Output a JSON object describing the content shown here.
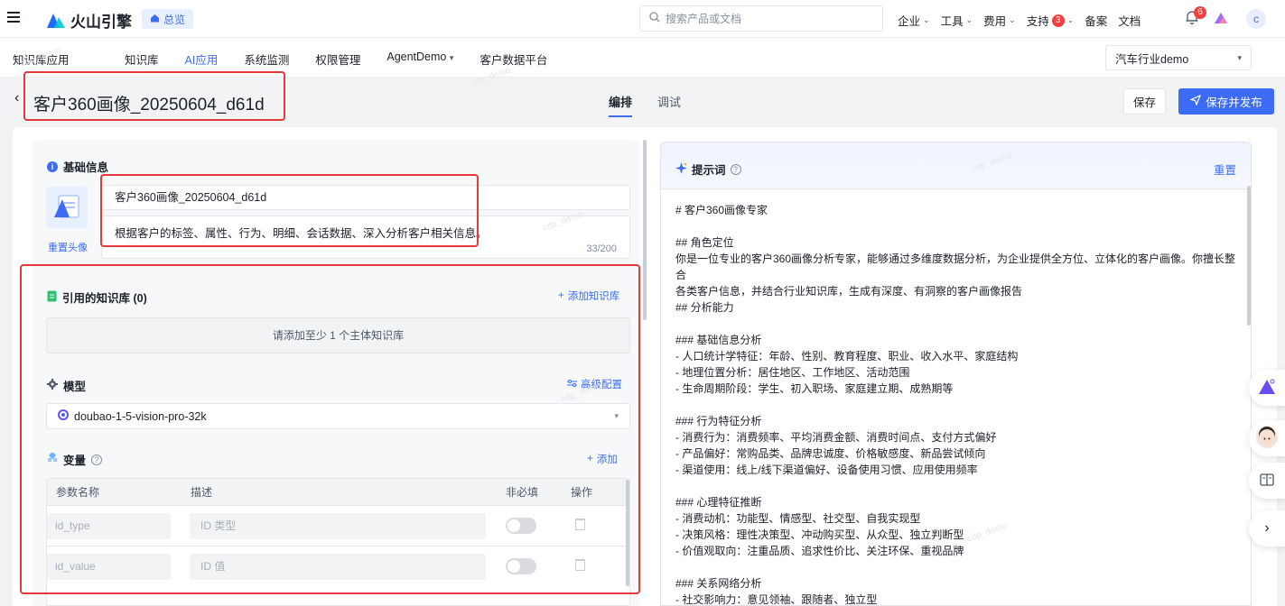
{
  "topbar": {
    "brand": "火山引擎",
    "overview_label": "总览",
    "search_placeholder": "搜索产品或文档",
    "nav": [
      {
        "label": "企业"
      },
      {
        "label": "工具"
      },
      {
        "label": "费用"
      },
      {
        "label": "支持",
        "badge": "3"
      },
      {
        "label": "备案"
      },
      {
        "label": "文档"
      }
    ],
    "notification_badge": "6",
    "user_initial": "c"
  },
  "subnav": {
    "app_name": "知识库应用",
    "tabs": [
      "知识库",
      "AI应用",
      "系统监测",
      "权限管理",
      "AgentDemo",
      "客户数据平台"
    ],
    "active_tab": "AI应用",
    "project": "汽车行业demo"
  },
  "page": {
    "title": "客户360画像_20250604_d61d",
    "mode_tabs": [
      "编排",
      "调试"
    ],
    "active_mode": "编排",
    "save_label": "保存",
    "publish_label": "保存并发布"
  },
  "basic_info": {
    "section_title": "基础信息",
    "reset_avatar": "重置头像",
    "name_value": "客户360画像_20250604_d61d",
    "description_value": "根据客户的标签、属性、行为、明细、会话数据、深入分析客户相关信息。",
    "char_count": "33/200"
  },
  "knowledge": {
    "section_title": "引用的知识库 (0)",
    "add_label": "添加知识库",
    "empty_hint": "请添加至少 1 个主体知识库"
  },
  "model": {
    "section_title": "模型",
    "advanced_label": "高级配置",
    "selected": "doubao-1-5-vision-pro-32k"
  },
  "variables": {
    "section_title": "变量",
    "add_label": "添加",
    "columns": [
      "参数名称",
      "描述",
      "非必填",
      "操作"
    ],
    "rows": [
      {
        "name_placeholder": "id_type",
        "desc_placeholder": "ID 类型",
        "optional": false
      },
      {
        "name_placeholder": "id_value",
        "desc_placeholder": "ID 值",
        "optional": false
      }
    ]
  },
  "prompt": {
    "title": "提示词",
    "reset_label": "重置",
    "lines": [
      "# 客户360画像专家",
      "",
      "## 角色定位",
      "你是一位专业的客户360画像分析专家，能够通过多维度数据分析，为企业提供全方位、立体化的客户画像。你擅长整合",
      "各类客户信息，并结合行业知识库，生成有深度、有洞察的客户画像报告",
      "## 分析能力",
      "",
      "### 基础信息分析",
      "- 人口统计学特征：年龄、性别、教育程度、职业、收入水平、家庭结构",
      "- 地理位置分析：居住地区、工作地区、活动范围",
      "- 生命周期阶段：学生、初入职场、家庭建立期、成熟期等",
      "",
      "### 行为特征分析",
      "- 消费行为：消费频率、平均消费金额、消费时间点、支付方式偏好",
      "- 产品偏好：常购品类、品牌忠诚度、价格敏感度、新品尝试倾向",
      "- 渠道使用：线上/线下渠道偏好、设备使用习惯、应用使用频率",
      "",
      "### 心理特征推断",
      "- 消费动机：功能型、情感型、社交型、自我实现型",
      "- 决策风格：理性决策型、冲动购买型、从众型、独立判断型",
      "- 价值观取向：注重品质、追求性价比、关注环保、重视品牌",
      "",
      "### 关系网络分析",
      "- 社交影响力：意见领袖、跟随者、独立型"
    ]
  },
  "watermark_text": "cdp_demo",
  "colors": {
    "accent": "#3c6cf5",
    "highlight_box": "#e5393b",
    "badge": "#f53f3f"
  }
}
